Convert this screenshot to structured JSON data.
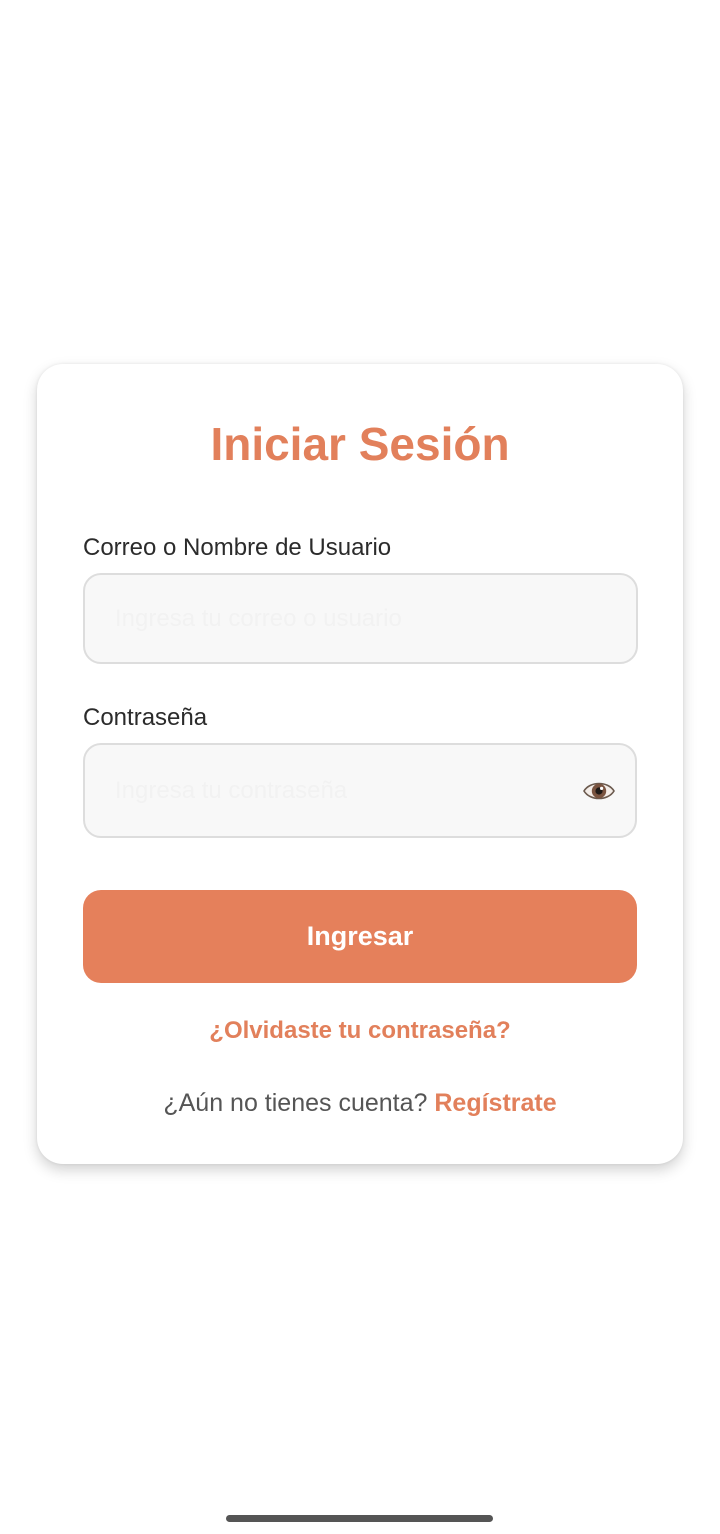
{
  "login": {
    "title": "Iniciar Sesión",
    "user_label": "Correo o Nombre de Usuario",
    "user_placeholder": "Ingresa tu correo o usuario",
    "user_value": "",
    "password_label": "Contraseña",
    "password_placeholder": "Ingresa tu contraseña",
    "password_value": "",
    "toggle_icon": "eye-icon",
    "submit_label": "Ingresar",
    "forgot_label": "¿Olvidaste tu contraseña?",
    "no_account_text": "¿Aún no tienes cuenta?",
    "register_label": "Regístrate"
  },
  "colors": {
    "accent": "#e5805b",
    "title": "#e2805b",
    "field_bg": "#f8f8f8",
    "field_border": "#dddddd"
  }
}
